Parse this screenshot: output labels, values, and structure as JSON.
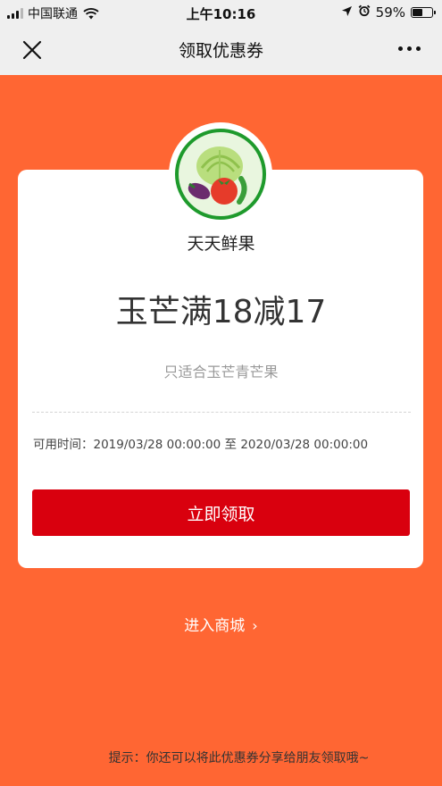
{
  "status_bar": {
    "carrier": "中国联通",
    "time": "上午10:16",
    "battery_percent": "59%",
    "battery_level": 0.59,
    "signal_bars_filled": 3,
    "icons": [
      "signal-icon",
      "wifi-icon",
      "location-arrow-icon",
      "alarm-icon",
      "battery-icon"
    ]
  },
  "navbar": {
    "title": "领取优惠券",
    "close_icon": "close-icon",
    "more_icon": "more-dots-icon"
  },
  "coupon": {
    "shop_logo": "vegetable-logo",
    "shop_name": "天天鲜果",
    "title": "玉芒满18减17",
    "description": "只适合玉芒青芒果",
    "validity_label": "可用时间：",
    "validity_start": "2019/03/28 00:00:00",
    "validity_sep": "至",
    "validity_end": "2020/03/28 00:00:00",
    "claim_button": "立即领取"
  },
  "footer": {
    "enter_mall": "进入商城",
    "enter_mall_icon": "chevron-right-icon",
    "tip": "提示：你还可以将此优惠券分享给朋友领取哦~"
  },
  "colors": {
    "background": "#FF6633",
    "claim_button": "#D9000E",
    "bar_background": "#EFEFEF",
    "logo_green": "#1E9A2C"
  }
}
